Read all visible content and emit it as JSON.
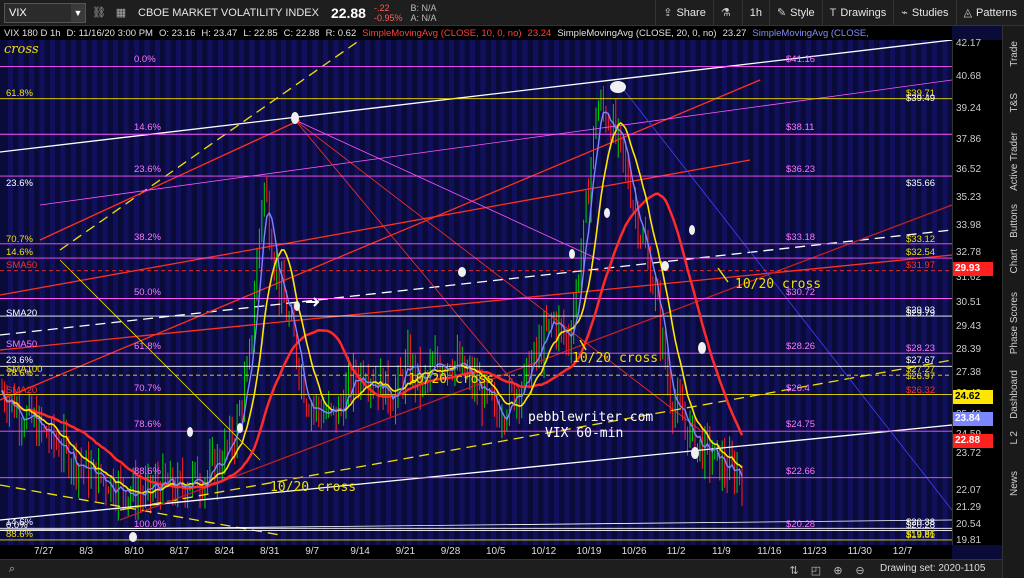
{
  "toolbar": {
    "symbol": "VIX",
    "instrument_name": "CBOE MARKET VOLATILITY INDEX",
    "last_price": "22.88",
    "net_change": "-.22",
    "pct_change": "-0.95%",
    "bid": "B: N/A",
    "ask": "A: N/A",
    "share_label": "Share",
    "timeframe_label": "1h",
    "style_label": "Style",
    "drawings_label": "Drawings",
    "studies_label": "Studies",
    "patterns_label": "Patterns"
  },
  "status_line": {
    "title": "VIX 180 D 1h",
    "date": "D: 11/16/20 3:00 PM",
    "open": "O: 23.16",
    "high": "H: 23.47",
    "low": "L: 22.85",
    "close": "C: 22.88",
    "range": "R: 0.62",
    "sma10_label": "SimpleMovingAvg (CLOSE, 10, 0, no)",
    "sma10_value": "23.24",
    "sma20_label": "SimpleMovingAvg (CLOSE, 20, 0, no)",
    "sma20_value": "23.27",
    "sma_extra_label": "SimpleMovingAvg (CLOSE,"
  },
  "price_axis": {
    "ticks": [
      "42.17",
      "40.68",
      "39.24",
      "37.86",
      "36.52",
      "35.23",
      "33.98",
      "32.78",
      "31.62",
      "30.51",
      "29.43",
      "28.39",
      "27.38",
      "26.42",
      "25.48",
      "24.59",
      "23.72",
      "22.07",
      "21.29",
      "20.54",
      "19.81"
    ],
    "current_price_tag": "29.93",
    "tag_24": "24.62",
    "tag_23": "23.84",
    "tag_22": "22.88"
  },
  "fib_labels": {
    "left": [
      "0.0%",
      "14.6%",
      "23.6%",
      "38.2%",
      "50.0%",
      "61.8%",
      "70.7%",
      "78.6%",
      "88.6%",
      "100.0%"
    ],
    "left_values": [
      "$41.16",
      "$38.11",
      "$36.23",
      "$33.18",
      "$30.72",
      "$28.26",
      "$26.4",
      "$24.75",
      "$22.66",
      "$20.28"
    ],
    "far_left": [
      "61.8%",
      "23.6%",
      "70.7%",
      "14.6%",
      "SMA50",
      "SMA20",
      "SMA50",
      "23.6%",
      "78.6%",
      "SMA100",
      "SMA20",
      "14.6%",
      "0.0%",
      "88.6%"
    ],
    "right_values": [
      "$39.71",
      "$39.49",
      "$35.66",
      "$33.12",
      "$32.54",
      "$31.97",
      "$29.93",
      "$29.79",
      "$28.23",
      "$27.67",
      "$27.27",
      "$26.97",
      "$26.32",
      "$20.38",
      "$20.28",
      "$19.86",
      "$19.81"
    ]
  },
  "annotations": {
    "cross1": "10/20 cross",
    "cross2": "10/20 cross",
    "cross3": "10/20 cross",
    "cross4": "10/20 cross",
    "cross_top_left": "cross",
    "watermark_line1": "pebblewriter.com",
    "watermark_line2": "VIX 60-min"
  },
  "date_axis": [
    "7/27",
    "8/3",
    "8/10",
    "8/17",
    "8/24",
    "8/31",
    "9/7",
    "9/14",
    "9/21",
    "9/28",
    "10/5",
    "10/12",
    "10/19",
    "10/26",
    "11/2",
    "11/9",
    "11/16",
    "11/23",
    "11/30",
    "12/7"
  ],
  "sidebar": [
    "Trade",
    "T&S",
    "Active Trader",
    "Buttons",
    "Chart",
    "Phase Scores",
    "Dashboard",
    "L 2",
    "News"
  ],
  "bottom": {
    "drawing_set": "Drawing set: 2020-1105"
  },
  "colors": {
    "background": "#0b0b3a",
    "up": "#00d000",
    "down": "#ff2020",
    "sma10": "#ffe600",
    "sma20": "#ff2a2a",
    "sma_blue": "#7b86ff",
    "fib": "#ff55ff"
  },
  "chart_data": {
    "type": "candlestick",
    "symbol": "VIX",
    "interval": "1h",
    "ylim": [
      19.81,
      42.17
    ],
    "x_ticks": [
      "7/27",
      "8/3",
      "8/10",
      "8/17",
      "8/24",
      "8/31",
      "9/7",
      "9/14",
      "9/21",
      "9/28",
      "10/5",
      "10/12",
      "10/19",
      "10/26",
      "11/2",
      "11/9",
      "11/16",
      "11/23",
      "11/30",
      "12/7"
    ],
    "last_bar": {
      "date": "11/16/20 3:00 PM",
      "open": 23.16,
      "high": 23.47,
      "low": 22.85,
      "close": 22.88
    },
    "close_path": [
      26.6,
      25.8,
      25.2,
      24.6,
      24.1,
      23.5,
      22.9,
      22.6,
      22.3,
      22.0,
      21.9,
      22.4,
      22.1,
      22.6,
      22.7,
      23.4,
      24.5,
      27.5,
      36.0,
      31.5,
      29.1,
      26.2,
      25.6,
      25.4,
      26.8,
      27.6,
      26.9,
      26.3,
      27.8,
      26.7,
      27.9,
      28.0,
      27.2,
      26.6,
      25.5,
      26.2,
      27.0,
      28.4,
      29.8,
      28.7,
      33.0,
      39.5,
      38.6,
      36.5,
      33.8,
      31.0,
      26.5,
      25.1,
      24.1,
      23.6,
      23.0,
      22.9
    ],
    "series": [
      {
        "name": "SimpleMovingAvg (CLOSE, 10, 0, no)",
        "last": 23.24
      },
      {
        "name": "SimpleMovingAvg (CLOSE, 20, 0, no)",
        "last": 23.27
      }
    ]
  }
}
